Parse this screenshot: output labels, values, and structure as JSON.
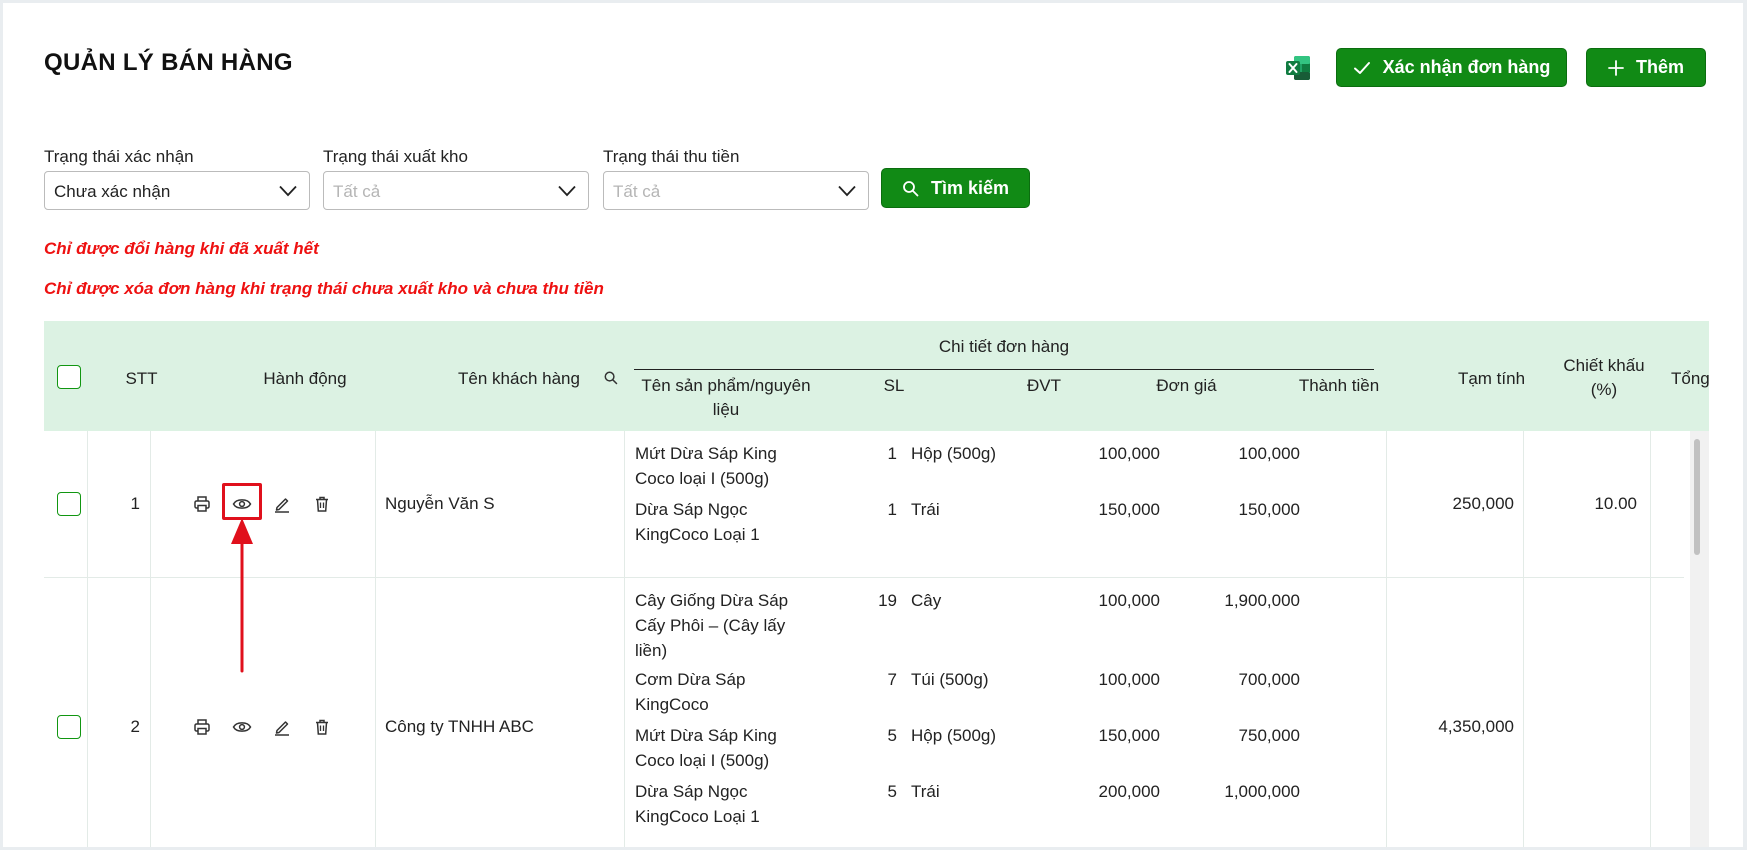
{
  "page": {
    "title": "QUẢN LÝ BÁN HÀNG"
  },
  "toolbar": {
    "excel_icon": "excel-icon",
    "confirm_label": "Xác nhận đơn hàng",
    "add_label": "Thêm"
  },
  "filters": {
    "confirm_status": {
      "label": "Trạng thái xác nhận",
      "value": "Chưa xác nhận"
    },
    "export_status": {
      "label": "Trạng thái xuất kho",
      "placeholder": "Tất cả"
    },
    "payment_status": {
      "label": "Trạng thái thu tiền",
      "placeholder": "Tất cả"
    },
    "search_label": "Tìm kiếm"
  },
  "warnings": [
    "Chỉ được đổi hàng khi đã xuất hết",
    "Chỉ được xóa đơn hàng khi trạng thái chưa xuất kho và chưa thu tiền"
  ],
  "table": {
    "headers": {
      "stt": "STT",
      "actions": "Hành động",
      "customer": "Tên khách hàng",
      "detail_group": "Chi tiết đơn hàng",
      "product": "Tên sản phẩm/nguyên liệu",
      "qty": "SL",
      "unit": "ĐVT",
      "price": "Đơn giá",
      "amount": "Thành tiền",
      "subtotal": "Tạm tính",
      "discount": "Chiết khấu (%)",
      "total": "Tổng"
    },
    "rows": [
      {
        "stt": "1",
        "customer": "Nguyễn Văn S",
        "items": [
          {
            "product": "Mứt Dừa Sáp King Coco loại I (500g)",
            "qty": "1",
            "unit": "Hộp (500g)",
            "price": "100,000",
            "amount": "100,000"
          },
          {
            "product": "Dừa Sáp Ngọc KingCoco Loại 1",
            "qty": "1",
            "unit": "Trái",
            "price": "150,000",
            "amount": "150,000"
          }
        ],
        "subtotal": "250,000",
        "discount": "10.00"
      },
      {
        "stt": "2",
        "customer": "Công ty TNHH ABC",
        "items": [
          {
            "product": "Cây Giống Dừa Sáp Cấy Phôi – (Cây lấy liền)",
            "qty": "19",
            "unit": "Cây",
            "price": "100,000",
            "amount": "1,900,000"
          },
          {
            "product": "Cơm Dừa Sáp KingCoco",
            "qty": "7",
            "unit": "Túi (500g)",
            "price": "100,000",
            "amount": "700,000"
          },
          {
            "product": "Mứt Dừa Sáp King Coco loại I (500g)",
            "qty": "5",
            "unit": "Hộp (500g)",
            "price": "150,000",
            "amount": "750,000"
          },
          {
            "product": "Dừa Sáp Ngọc KingCoco Loại 1",
            "qty": "5",
            "unit": "Trái",
            "price": "200,000",
            "amount": "1,000,000"
          }
        ],
        "subtotal": "4,350,000",
        "discount": ""
      }
    ]
  },
  "colors": {
    "primary_green": "#118a15",
    "header_bg": "#dcf2e3",
    "warning_red": "#ee1111",
    "highlight_red": "#e0101c"
  }
}
